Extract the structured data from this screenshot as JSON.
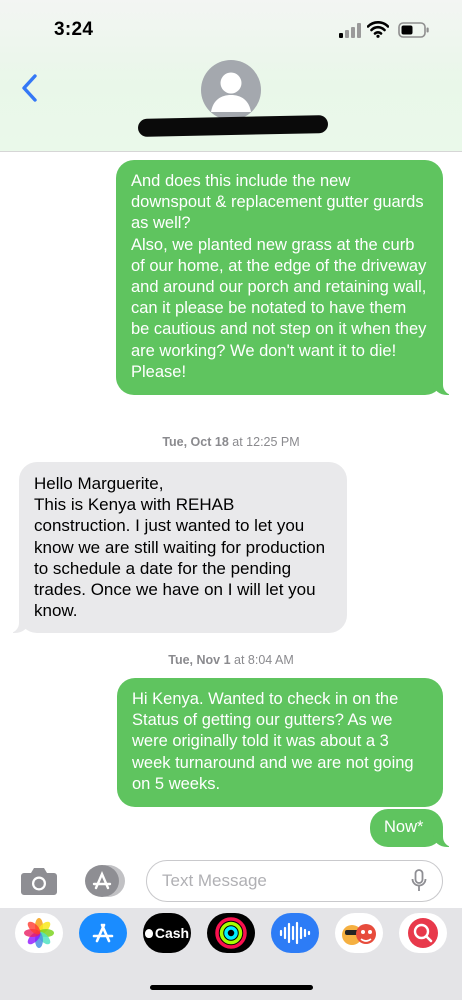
{
  "status_bar": {
    "time": "3:24"
  },
  "messages": [
    {
      "dir": "out",
      "text": "And does this include the new downspout & replacement gutter guards as well?\nAlso, we planted new grass at the curb of our home, at the edge of the driveway and around our porch and retaining wall, can it please be notated to have them be cautious and not step on it when they are working? We don't want it to die! Please!"
    },
    {
      "dir": "in",
      "text": "Hello Marguerite,\nThis is Kenya with REHAB construction. I just wanted to let you know we are still waiting for production to schedule a date for the pending trades. Once we have on I will let you know."
    },
    {
      "dir": "out",
      "text": "Hi Kenya. Wanted to check in on the Status of getting our gutters? As we were originally told it was about a 3 week turnaround and we are not going on 5 weeks."
    },
    {
      "dir": "out",
      "text": "Now*"
    }
  ],
  "timestamps": [
    {
      "day": "Tue, Oct 18",
      "time": "at 12:25 PM"
    },
    {
      "day": "Tue, Nov 1",
      "time": "at 8:04 AM"
    }
  ],
  "input": {
    "placeholder": "Text Message"
  },
  "app_drawer": {
    "cash_label": "Cash",
    "apps": [
      "photos-icon",
      "app-store-icon",
      "apple-cash-icon",
      "activity-icon",
      "audio-message-icon",
      "memoji-icon",
      "image-search-icon"
    ]
  },
  "colors": {
    "sent_bubble": "#5fc45f",
    "received_bubble": "#e9e9eb",
    "accent": "#3478f6"
  }
}
